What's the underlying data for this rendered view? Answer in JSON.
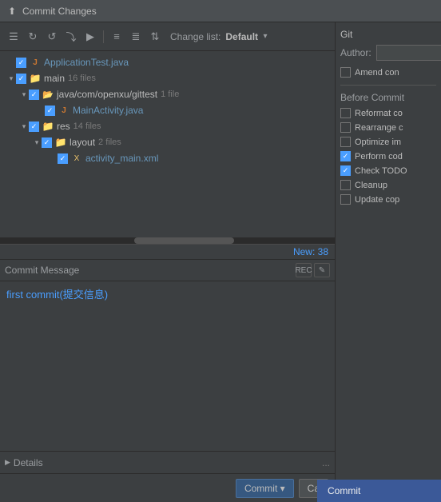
{
  "titleBar": {
    "title": "Commit Changes",
    "icon": "⬆"
  },
  "toolbar": {
    "changeListLabel": "Change list:",
    "changeListValue": "Default",
    "buttons": [
      "↻",
      "↺",
      "⤵",
      "▶",
      "≡",
      "≣",
      "⇅"
    ]
  },
  "fileTree": {
    "items": [
      {
        "indent": 0,
        "checked": true,
        "expanded": false,
        "type": "java",
        "name": "ApplicationTest.java",
        "count": ""
      },
      {
        "indent": 1,
        "checked": true,
        "expanded": true,
        "type": "folder",
        "name": "main",
        "count": "16 files"
      },
      {
        "indent": 2,
        "checked": true,
        "expanded": true,
        "type": "folder-src",
        "name": "java/com/openxu/gittest",
        "count": "1 file"
      },
      {
        "indent": 3,
        "checked": true,
        "expanded": false,
        "type": "java",
        "name": "MainActivity.java",
        "count": ""
      },
      {
        "indent": 2,
        "checked": true,
        "expanded": true,
        "type": "folder",
        "name": "res",
        "count": "14 files"
      },
      {
        "indent": 3,
        "checked": true,
        "expanded": true,
        "type": "folder",
        "name": "layout",
        "count": "2 files"
      },
      {
        "indent": 4,
        "checked": true,
        "expanded": false,
        "type": "xml",
        "name": "activity_main.xml",
        "count": ""
      }
    ],
    "newCount": "New: 38"
  },
  "commitMessage": {
    "title": "Commit Message",
    "text": "first commit(提交信息)",
    "recLabel": "REC",
    "editLabel": "✎"
  },
  "details": {
    "label": "Details",
    "dots": "..."
  },
  "bottomBar": {
    "commitLabel": "Commit ▾",
    "cancelLabel": "Ca"
  },
  "commitDropdown": {
    "items": [
      "Commit"
    ]
  },
  "rightPanel": {
    "gitTitle": "Git",
    "authorLabel": "Author:",
    "authorValue": "",
    "amendLabel": "Amend con",
    "beforeCommitTitle": "Before Commit",
    "options": [
      {
        "checked": false,
        "label": "Reformat co"
      },
      {
        "checked": false,
        "label": "Rearrange c"
      },
      {
        "checked": false,
        "label": "Optimize im"
      },
      {
        "checked": true,
        "label": "Perform cod"
      },
      {
        "checked": true,
        "label": "Check TODO"
      },
      {
        "checked": false,
        "label": "Cleanup"
      },
      {
        "checked": false,
        "label": "Update cop"
      }
    ]
  }
}
